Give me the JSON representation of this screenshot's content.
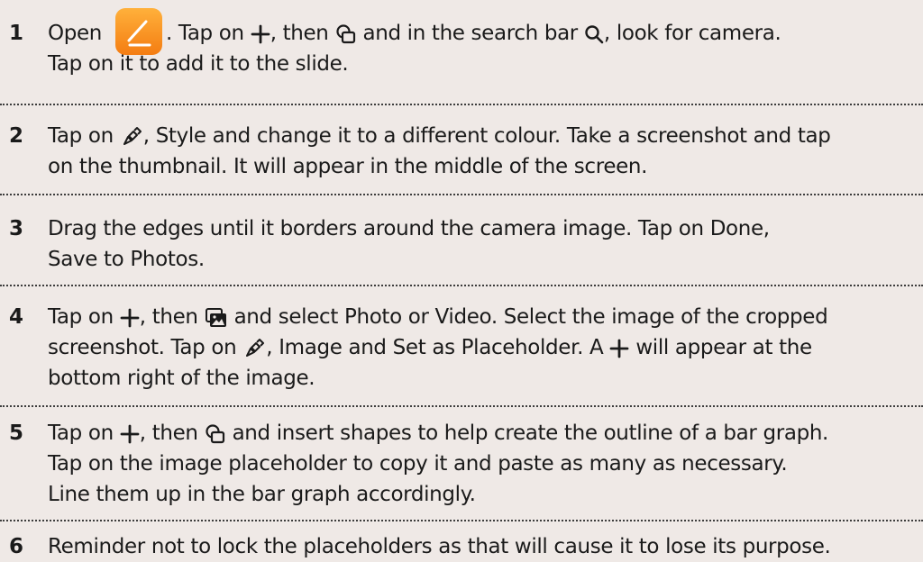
{
  "steps": [
    {
      "number": "1",
      "line1": {
        "a": "Open",
        "b": ". Tap on",
        "c": ", then",
        "d": "and in the search bar",
        "e": ", look for camera."
      },
      "line2": "Tap on it to add it to the slide."
    },
    {
      "number": "2",
      "line1": {
        "a": "Tap on",
        "b": ", Style and change it to a different colour. Take a screenshot and tap"
      },
      "line2": "on the thumbnail. It will appear in the middle of the screen."
    },
    {
      "number": "3",
      "line1": "Drag the edges until it borders around the camera image. Tap on Done,",
      "line2": "Save to Photos."
    },
    {
      "number": "4",
      "line1": {
        "a": "Tap on",
        "b": ", then",
        "c": "and select Photo or Video. Select the image of the cropped"
      },
      "line2": {
        "a": "screenshot. Tap on",
        "b": ", Image and Set as Placeholder. A",
        "c": "will appear at the"
      },
      "line3": "bottom right of the image."
    },
    {
      "number": "5",
      "line1": {
        "a": "Tap on",
        "b": ", then",
        "c": "and insert shapes to help create the outline of a bar graph."
      },
      "line2": "Tap on the image placeholder to copy it and paste as many as necessary.",
      "line3": "Line them up in the bar graph accordingly."
    },
    {
      "number": "6",
      "line1": "Reminder not to lock the placeholders as that will cause it to lose its purpose."
    }
  ],
  "icons": {
    "app": "pages-app-icon",
    "plus": "plus-icon",
    "shapes": "shapes-icon",
    "search": "search-icon",
    "format": "format-brush-icon",
    "media": "media-icon"
  },
  "colors": {
    "background": "#efe9e6",
    "text": "#1a1a1a",
    "app_icon_top": "#ffb13b",
    "app_icon_bottom": "#f47d12"
  }
}
